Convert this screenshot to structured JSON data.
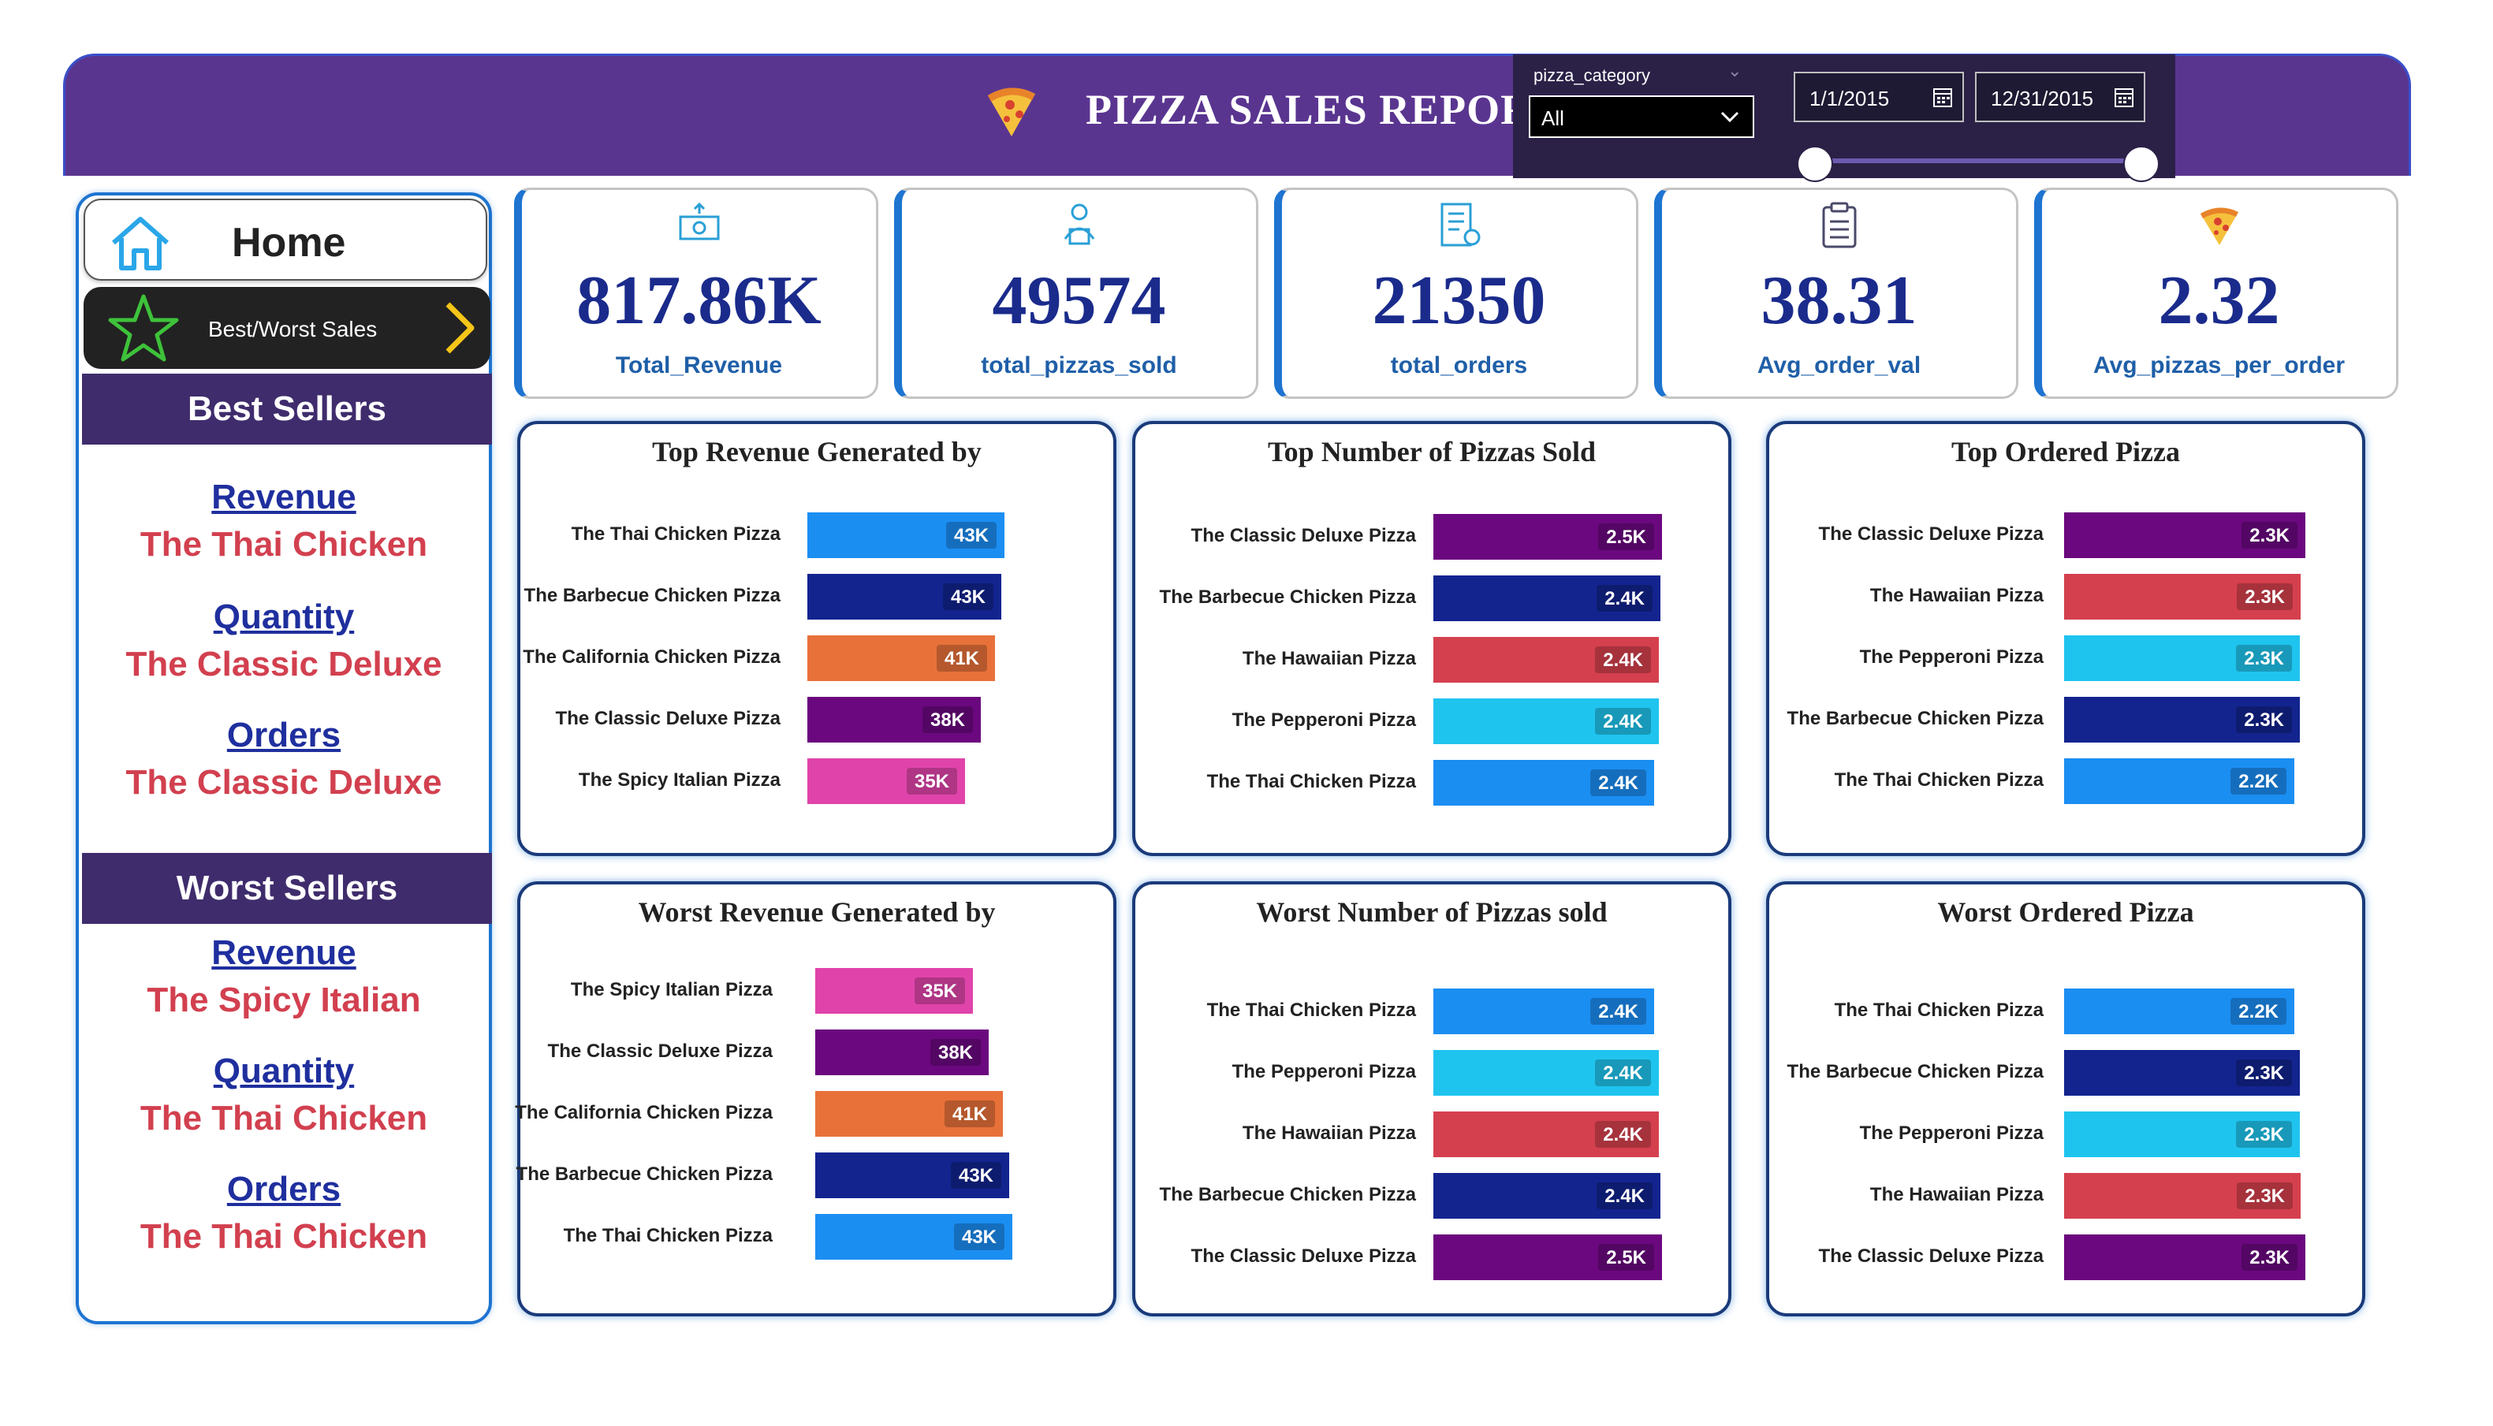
{
  "header": {
    "title": "PIZZA SALES REPORT",
    "icon": "pizza-icon",
    "filter": {
      "label": "pizza_category",
      "selected": "All",
      "date_start": "1/1/2015",
      "date_end": "12/31/2015"
    }
  },
  "sidebar": {
    "home_label": "Home",
    "nav_label": "Best/Worst Sales",
    "best": {
      "heading": "Best Sellers",
      "items": [
        {
          "category": "Revenue",
          "name": "The Thai Chicken"
        },
        {
          "category": "Quantity",
          "name": "The Classic Deluxe"
        },
        {
          "category": "Orders",
          "name": "The Classic Deluxe"
        }
      ]
    },
    "worst": {
      "heading": "Worst Sellers",
      "items": [
        {
          "category": "Revenue",
          "name": "The Spicy Italian"
        },
        {
          "category": "Quantity",
          "name": "The Thai Chicken"
        },
        {
          "category": "Orders",
          "name": "The Thai Chicken"
        }
      ]
    }
  },
  "kpis": [
    {
      "value": "817.86K",
      "label": "Total_Revenue",
      "icon": "money-icon"
    },
    {
      "value": "49574",
      "label": "total_pizzas_sold",
      "icon": "delivery-icon"
    },
    {
      "value": "21350",
      "label": "total_orders",
      "icon": "order-list-icon"
    },
    {
      "value": "38.31",
      "label": "Avg_order_val",
      "icon": "clipboard-icon"
    },
    {
      "value": "2.32",
      "label": "Avg_pizzas_per_order",
      "icon": "pizza-icon"
    }
  ],
  "colors": {
    "The Thai Chicken Pizza": "#1b8ef2",
    "The Barbecue Chicken Pizza": "#13248f",
    "The California Chicken Pizza": "#e8713a",
    "The Classic Deluxe Pizza": "#6b087f",
    "The Spicy Italian Pizza": "#e044ab",
    "The Hawaiian Pizza": "#d5404e",
    "The Pepperoni Pizza": "#1fc4ee"
  },
  "chart_data": [
    {
      "type": "bar",
      "title": "Top Revenue Generated by",
      "categories": [
        "The Thai Chicken Pizza",
        "The Barbecue Chicken Pizza",
        "The California Chicken Pizza",
        "The Classic Deluxe Pizza",
        "The Spicy Italian Pizza"
      ],
      "values": [
        43434,
        42768,
        41410,
        38181,
        34832
      ],
      "labels": [
        "43K",
        "43K",
        "41K",
        "38K",
        "35K"
      ]
    },
    {
      "type": "bar",
      "title": "Top Number of Pizzas Sold",
      "categories": [
        "The Classic Deluxe Pizza",
        "The Barbecue Chicken Pizza",
        "The Hawaiian Pizza",
        "The Pepperoni Pizza",
        "The Thai Chicken Pizza"
      ],
      "values": [
        2453,
        2432,
        2422,
        2418,
        2371
      ],
      "labels": [
        "2.5K",
        "2.4K",
        "2.4K",
        "2.4K",
        "2.4K"
      ]
    },
    {
      "type": "bar",
      "title": "Top Ordered Pizza",
      "categories": [
        "The Classic Deluxe Pizza",
        "The Hawaiian Pizza",
        "The Pepperoni Pizza",
        "The Barbecue Chicken Pizza",
        "The Thai Chicken Pizza"
      ],
      "values": [
        2329,
        2280,
        2278,
        2273,
        2225
      ],
      "labels": [
        "2.3K",
        "2.3K",
        "2.3K",
        "2.3K",
        "2.2K"
      ]
    },
    {
      "type": "bar",
      "title": "Worst Revenue Generated by",
      "categories": [
        "The Spicy Italian Pizza",
        "The Classic Deluxe Pizza",
        "The California Chicken Pizza",
        "The Barbecue Chicken Pizza",
        "The Thai Chicken Pizza"
      ],
      "values": [
        34832,
        38181,
        41410,
        42768,
        43434
      ],
      "labels": [
        "35K",
        "38K",
        "41K",
        "43K",
        "43K"
      ]
    },
    {
      "type": "bar",
      "title": "Worst Number of Pizzas sold",
      "categories": [
        "The Thai Chicken Pizza",
        "The Pepperoni Pizza",
        "The Hawaiian Pizza",
        "The Barbecue Chicken Pizza",
        "The Classic Deluxe Pizza"
      ],
      "values": [
        2371,
        2418,
        2422,
        2432,
        2453
      ],
      "labels": [
        "2.4K",
        "2.4K",
        "2.4K",
        "2.4K",
        "2.5K"
      ]
    },
    {
      "type": "bar",
      "title": "Worst Ordered Pizza",
      "categories": [
        "The Thai Chicken Pizza",
        "The Barbecue Chicken Pizza",
        "The Pepperoni Pizza",
        "The Hawaiian Pizza",
        "The Classic Deluxe Pizza"
      ],
      "values": [
        2225,
        2273,
        2278,
        2280,
        2329
      ],
      "labels": [
        "2.2K",
        "2.3K",
        "2.3K",
        "2.3K",
        "2.3K"
      ]
    }
  ]
}
